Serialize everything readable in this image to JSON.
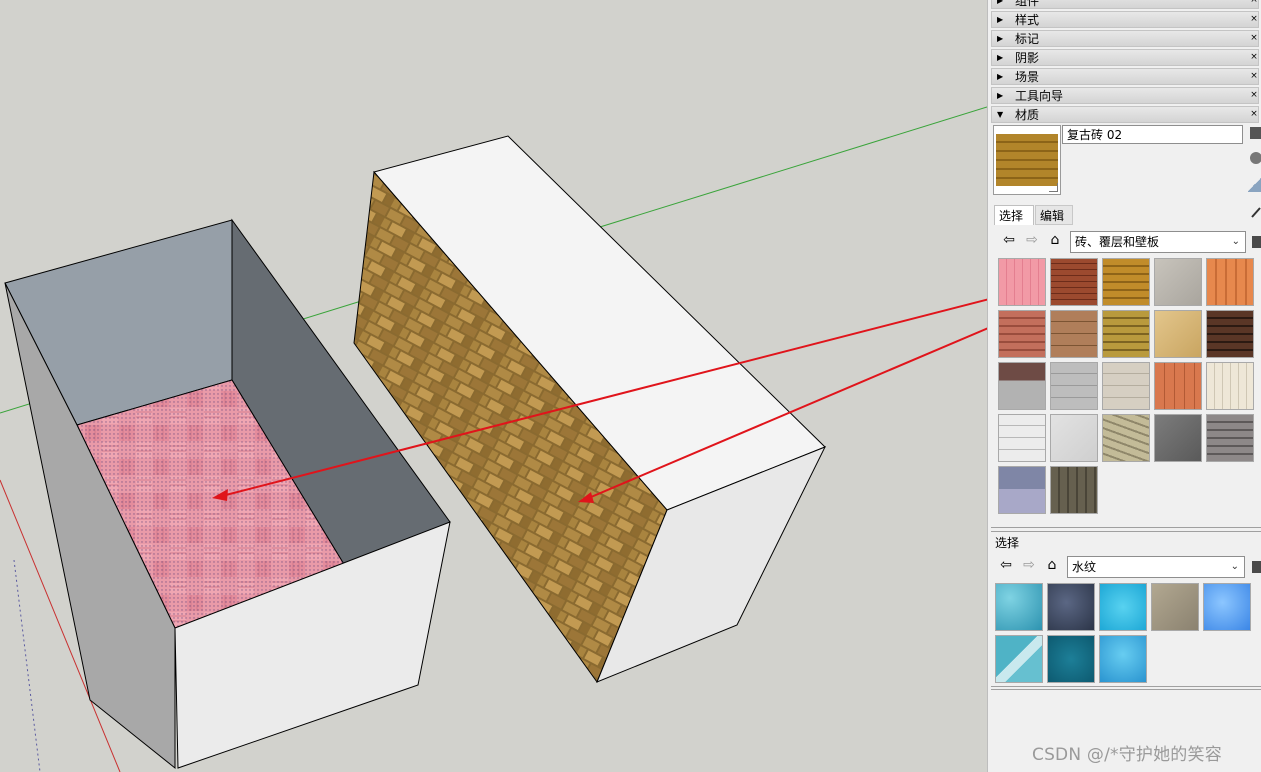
{
  "tray_rows": [
    {
      "label": "组件",
      "expanded": false
    },
    {
      "label": "样式",
      "expanded": false
    },
    {
      "label": "标记",
      "expanded": false
    },
    {
      "label": "阴影",
      "expanded": false
    },
    {
      "label": "场景",
      "expanded": false
    },
    {
      "label": "工具向导",
      "expanded": false
    },
    {
      "label": "材质",
      "expanded": true
    }
  ],
  "material": {
    "name": "复古砖 02"
  },
  "tabs": {
    "select": "选择",
    "edit": "编辑"
  },
  "library1": {
    "collection": "砖、覆层和壁板",
    "swatch_icons": [
      "pink-tile-swatch",
      "red-brick-swatch",
      "antique-brick-swatch",
      "gray-stone-swatch",
      "orange-siding-swatch",
      "red-stone-swatch",
      "brown-board-swatch",
      "yellow-brick-swatch",
      "tan-stone-swatch",
      "dark-brick-swatch",
      "gray-speckle-swatch",
      "gray-block-swatch",
      "beige-block-swatch",
      "orange-plank-swatch",
      "cream-siding-swatch",
      "white-siding-swatch",
      "light-gray-swatch",
      "rubble-stone-swatch",
      "dark-tile-swatch",
      "gray-brick-swatch",
      "blue-granite-swatch",
      "dark-wood-swatch"
    ]
  },
  "library2": {
    "section_label": "选择",
    "collection": "水纹",
    "swatch_icons": [
      "pool-water-swatch",
      "dark-sparkle-water-swatch",
      "cyan-water-swatch",
      "stone-water-swatch",
      "blue-ripple-swatch",
      "reflect-water-swatch",
      "deep-blue-water-swatch",
      "caustic-water-swatch"
    ]
  },
  "colors": {
    "annotation_arrow": "#e0141b",
    "green_axis": "#3aa43a",
    "red_axis": "#c83030",
    "panel_bg": "#f0f0f0"
  },
  "watermark": "CSDN @/*守护她的笑容"
}
